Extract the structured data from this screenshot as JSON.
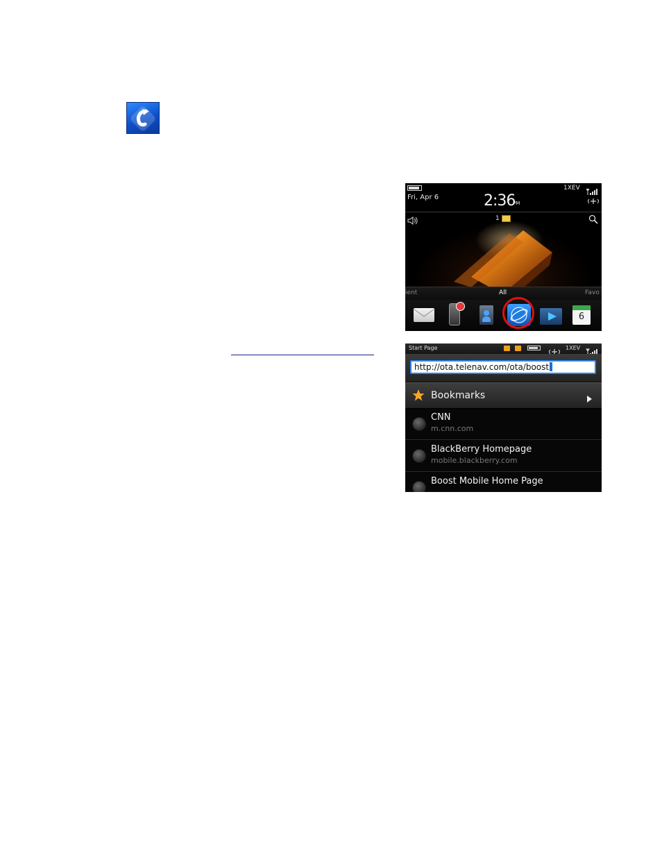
{
  "home_screen": {
    "date": "Fri, Apr 6",
    "time": "2:36",
    "ampm": "PM",
    "network": "1XEV",
    "notification_count": "1",
    "tabs": {
      "left_partial": "ient",
      "center": "All",
      "right_partial": "Favo"
    },
    "calendar_day": "6",
    "dock_icons": [
      "mail-icon",
      "messenger-icon",
      "contacts-icon",
      "browser-icon",
      "media-icon",
      "calendar-icon"
    ],
    "highlight_color": "#e01010"
  },
  "browser_screen": {
    "page_title": "Start Page",
    "network": "1XEV",
    "url": "http://ota.telenav.com/ota/boost",
    "bookmarks_label": "Bookmarks",
    "items": [
      {
        "title": "CNN",
        "url": "m.cnn.com"
      },
      {
        "title": "BlackBerry Homepage",
        "url": "mobile.blackberry.com"
      },
      {
        "title": "Boost Mobile Home Page",
        "url": ""
      }
    ],
    "accent": "#2e86e8"
  },
  "app_icon": {
    "name": "telenav-app-icon",
    "color": "#1a66e0"
  }
}
